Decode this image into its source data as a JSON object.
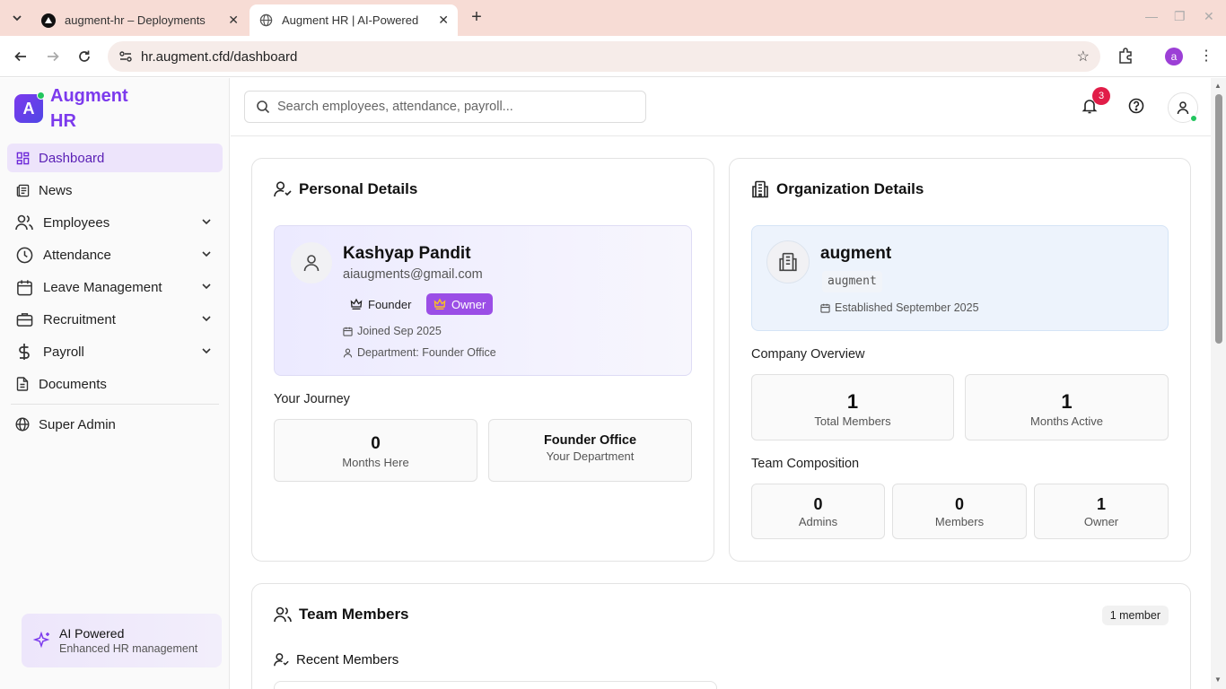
{
  "browser": {
    "tabs": [
      {
        "title": "augment-hr – Deployments",
        "active": false
      },
      {
        "title": "Augment HR | AI-Powered",
        "active": true
      }
    ],
    "url": "hr.augment.cfd/dashboard",
    "profile_initial": "a"
  },
  "brand": {
    "logo_letter": "A",
    "name": "Augment HR",
    "color": "#7c3aed"
  },
  "sidebar": {
    "items": [
      {
        "label": "Dashboard",
        "icon": "dashboard-icon",
        "active": true
      },
      {
        "label": "News",
        "icon": "newspaper-icon"
      },
      {
        "label": "Employees",
        "icon": "users-icon",
        "expandable": true
      },
      {
        "label": "Attendance",
        "icon": "clock-icon",
        "expandable": true
      },
      {
        "label": "Leave Management",
        "icon": "calendar-icon",
        "expandable": true
      },
      {
        "label": "Recruitment",
        "icon": "briefcase-icon",
        "expandable": true
      },
      {
        "label": "Payroll",
        "icon": "dollar-icon",
        "expandable": true
      },
      {
        "label": "Documents",
        "icon": "document-icon"
      },
      {
        "label": "Super Admin",
        "icon": "globe-icon"
      }
    ],
    "ai_card": {
      "title": "AI Powered",
      "subtitle": "Enhanced HR management"
    }
  },
  "header": {
    "search_placeholder": "Search employees, attendance, payroll...",
    "notifications_count": "3"
  },
  "personal": {
    "title": "Personal Details",
    "name": "Kashyap Pandit",
    "email": "aiaugments@gmail.com",
    "role_chip": "Founder",
    "owner_chip": "Owner",
    "joined": "Joined Sep 2025",
    "department": "Department: Founder Office",
    "journey_label": "Your Journey",
    "journey": [
      {
        "value": "0",
        "label": "Months Here"
      },
      {
        "value": "Founder Office",
        "label": "Your Department"
      }
    ]
  },
  "organization": {
    "title": "Organization Details",
    "name": "augment",
    "slug": "augment",
    "established": "Established September 2025",
    "overview_label": "Company Overview",
    "overview": [
      {
        "value": "1",
        "label": "Total Members"
      },
      {
        "value": "1",
        "label": "Months Active"
      }
    ],
    "composition_label": "Team Composition",
    "composition": [
      {
        "value": "0",
        "label": "Admins"
      },
      {
        "value": "0",
        "label": "Members"
      },
      {
        "value": "1",
        "label": "Owner"
      }
    ]
  },
  "team": {
    "title": "Team Members",
    "count": "1 member",
    "recent_label": "Recent Members"
  },
  "colors": {
    "accent": "#7c3aed",
    "owner_chip": "#9b4ee6",
    "notification": "#e11d48",
    "online": "#22c55e"
  }
}
